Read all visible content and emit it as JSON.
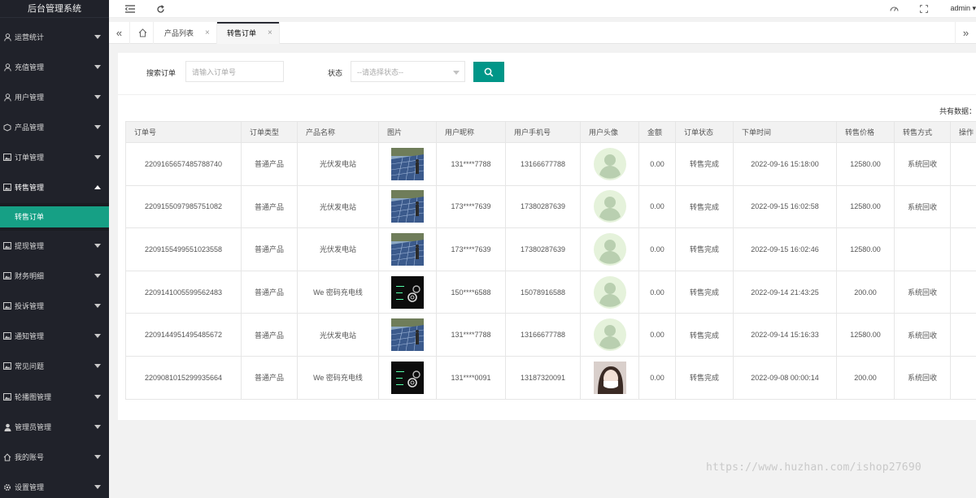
{
  "app": {
    "title": "后台管理系统"
  },
  "sidebar": {
    "items": [
      {
        "label": "运营统计",
        "icon": "user-icon",
        "expanded": false
      },
      {
        "label": "充值管理",
        "icon": "user-icon",
        "expanded": false
      },
      {
        "label": "用户管理",
        "icon": "user-icon",
        "expanded": false
      },
      {
        "label": "产品管理",
        "icon": "product-icon",
        "expanded": false
      },
      {
        "label": "订单管理",
        "icon": "image-icon",
        "expanded": false
      },
      {
        "label": "转售管理",
        "icon": "image-icon",
        "expanded": true
      },
      {
        "label": "提现管理",
        "icon": "image-icon",
        "expanded": false
      },
      {
        "label": "财务明细",
        "icon": "image-icon",
        "expanded": false
      },
      {
        "label": "投诉管理",
        "icon": "image-icon",
        "expanded": false
      },
      {
        "label": "通知管理",
        "icon": "image-icon",
        "expanded": false
      },
      {
        "label": "常见问题",
        "icon": "image-icon",
        "expanded": false
      },
      {
        "label": "轮播图管理",
        "icon": "image-icon",
        "expanded": false
      },
      {
        "label": "管理员管理",
        "icon": "person-icon",
        "expanded": false
      },
      {
        "label": "我的账号",
        "icon": "home-icon",
        "expanded": false
      },
      {
        "label": "设置管理",
        "icon": "gear-icon",
        "expanded": false
      }
    ],
    "active_sub": "转售订单"
  },
  "header": {
    "user": "admin"
  },
  "tabs": [
    {
      "label": "产品列表",
      "active": false
    },
    {
      "label": "转售订单",
      "active": true
    }
  ],
  "search": {
    "order_label": "搜索订单",
    "order_placeholder": "请输入订单号",
    "status_label": "状态",
    "status_placeholder": "--请选择状态--"
  },
  "total_label": "共有数据：",
  "table": {
    "columns": [
      "订单号",
      "订单类型",
      "产品名称",
      "图片",
      "用户昵称",
      "用户手机号",
      "用户头像",
      "金额",
      "订单状态",
      "下单时间",
      "转售价格",
      "转售方式",
      "操作"
    ],
    "rows": [
      {
        "order_no": "2209165657485788740",
        "type": "普通产品",
        "product": "光伏发电站",
        "image": "solar",
        "nickname": "131****7788",
        "phone": "13166677788",
        "avatar": "default",
        "amount": "0.00",
        "status": "转售完成",
        "time": "2022-09-16 15:18:00",
        "price": "12580.00",
        "method": "系统回收"
      },
      {
        "order_no": "2209155097985751082",
        "type": "普通产品",
        "product": "光伏发电站",
        "image": "solar",
        "nickname": "173****7639",
        "phone": "17380287639",
        "avatar": "default",
        "amount": "0.00",
        "status": "转售完成",
        "time": "2022-09-15 16:02:58",
        "price": "12580.00",
        "method": "系统回收"
      },
      {
        "order_no": "2209155499551023558",
        "type": "普通产品",
        "product": "光伏发电站",
        "image": "solar",
        "nickname": "173****7639",
        "phone": "17380287639",
        "avatar": "default",
        "amount": "0.00",
        "status": "转售完成",
        "time": "2022-09-15 16:02:46",
        "price": "12580.00",
        "method": ""
      },
      {
        "order_no": "2209141005599562483",
        "type": "普通产品",
        "product": "We 密码充电线",
        "image": "dark",
        "nickname": "150****6588",
        "phone": "15078916588",
        "avatar": "default",
        "amount": "0.00",
        "status": "转售完成",
        "time": "2022-09-14 21:43:25",
        "price": "200.00",
        "method": "系统回收"
      },
      {
        "order_no": "2209144951495485672",
        "type": "普通产品",
        "product": "光伏发电站",
        "image": "solar",
        "nickname": "131****7788",
        "phone": "13166677788",
        "avatar": "default",
        "amount": "0.00",
        "status": "转售完成",
        "time": "2022-09-14 15:16:33",
        "price": "12580.00",
        "method": "系统回收"
      },
      {
        "order_no": "2209081015299935664",
        "type": "普通产品",
        "product": "We 密码充电线",
        "image": "dark",
        "nickname": "131****0091",
        "phone": "13187320091",
        "avatar": "photo",
        "amount": "0.00",
        "status": "转售完成",
        "time": "2022-09-08 00:00:14",
        "price": "200.00",
        "method": "系统回收"
      }
    ]
  },
  "watermark": "https://www.huzhan.com/ishop27690",
  "colors": {
    "sidebar": "#20222a",
    "accent": "#009688",
    "active_sub": "#16a085"
  }
}
